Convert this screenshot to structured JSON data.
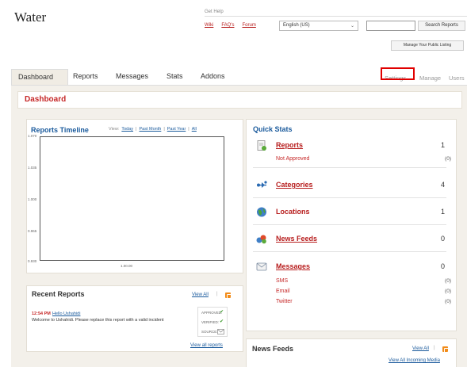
{
  "site": {
    "title": "Water"
  },
  "help": {
    "title": "Get Help",
    "links": [
      "Wiki",
      "FAQ's",
      "Forum"
    ]
  },
  "language": {
    "selected": "English (US)"
  },
  "search": {
    "value": "",
    "button_label": "Search Reports"
  },
  "manage_public_listing_label": "Manage Your Public Listing",
  "nav": {
    "tabs": [
      "Dashboard",
      "Reports",
      "Messages",
      "Stats",
      "Addons"
    ],
    "active_tab": "Dashboard",
    "right_tabs": [
      "Settings",
      "Manage",
      "Users"
    ],
    "highlighted_tab": "Settings"
  },
  "panel_title": "Dashboard",
  "timeline": {
    "title": "Reports Timeline",
    "view_label": "View:",
    "view_links": [
      "Today",
      "Past Month",
      "Past Year",
      "All"
    ]
  },
  "chart_data": {
    "type": "line",
    "title": "Reports Timeline",
    "yticks": [
      "1.070",
      "1.035",
      "1.000",
      "0.965",
      "0.930"
    ],
    "xticks": [
      "1.00.00"
    ],
    "series": []
  },
  "quick_stats": {
    "title": "Quick Stats",
    "reports": {
      "label": "Reports",
      "count": "1",
      "sub": [
        {
          "label": "Not Approved",
          "count": "(0)"
        }
      ]
    },
    "categories": {
      "label": "Categories",
      "count": "4"
    },
    "locations": {
      "label": "Locations",
      "count": "1"
    },
    "news_feeds": {
      "label": "News Feeds",
      "count": "0"
    },
    "messages": {
      "label": "Messages",
      "count": "0",
      "sub": [
        {
          "label": "SMS",
          "count": "(0)"
        },
        {
          "label": "Email",
          "count": "(0)"
        },
        {
          "label": "Twitter",
          "count": "(0)"
        }
      ]
    }
  },
  "recent_reports": {
    "title": "Recent Reports",
    "view_all": "View All",
    "items": [
      {
        "time": "12:54 PM",
        "title": "Hello Ushahidi",
        "text": "Welcome to Ushahidi. Please replace this report with a valid incident",
        "approved_label": "APPROVED:",
        "verified_label": "VERIFIED:",
        "source_label": "SOURCE:"
      }
    ],
    "view_all_reports": "View all reports"
  },
  "news_feeds": {
    "title": "News Feeds",
    "view_all": "View All",
    "view_all_incoming": "View All Incoming Media"
  },
  "colors": {
    "accent_red": "#c62828",
    "link_blue": "#1a5a9c",
    "highlight_box": "#e00000",
    "rss_orange": "#f28c1a"
  }
}
